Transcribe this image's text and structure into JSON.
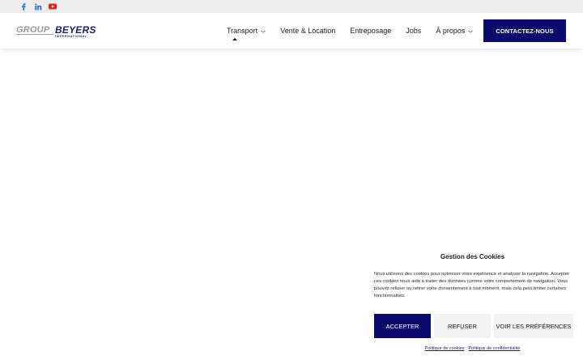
{
  "social": {
    "facebook_icon": "facebook-icon",
    "linkedin_icon": "linkedin-icon",
    "youtube_icon": "youtube-icon",
    "colors": {
      "facebook": "#1877f2",
      "linkedin": "#0a66c2",
      "youtube": "#e62117"
    }
  },
  "logo": {
    "group": "GROUP",
    "beyers": "BEYERS",
    "international": "INTERNATIONAL"
  },
  "nav": {
    "items": [
      {
        "label": "Transport",
        "has_dropdown": true,
        "active": true
      },
      {
        "label": "Vente & Location",
        "has_dropdown": false
      },
      {
        "label": "Entreposage",
        "has_dropdown": false
      },
      {
        "label": "Jobs",
        "has_dropdown": false
      },
      {
        "label": "À propos",
        "has_dropdown": true
      }
    ],
    "cta_label": "CONTACTEZ-NOUS"
  },
  "cookie_banner": {
    "title": "Gestion des Cookies",
    "text": "Nous utilisons des cookies pour optimiser votre expérience et analyser la navigation. Accepter ces cookies nous aide à traiter des données comme votre comportement de navigation. Vous pouvez refuser ou retirer votre consentement à tout moment, mais cela peut limiter certaines fonctionnalités.",
    "accept_label": "ACCEPTER",
    "refuse_label": "REFUSER",
    "prefs_label": "VOIR LES PRÉFÉRENCES",
    "links": [
      "Politique de cookies",
      "Politique de confidentialité"
    ]
  },
  "colors": {
    "brand": "#0b0b6e",
    "topbar": "#ececec"
  }
}
